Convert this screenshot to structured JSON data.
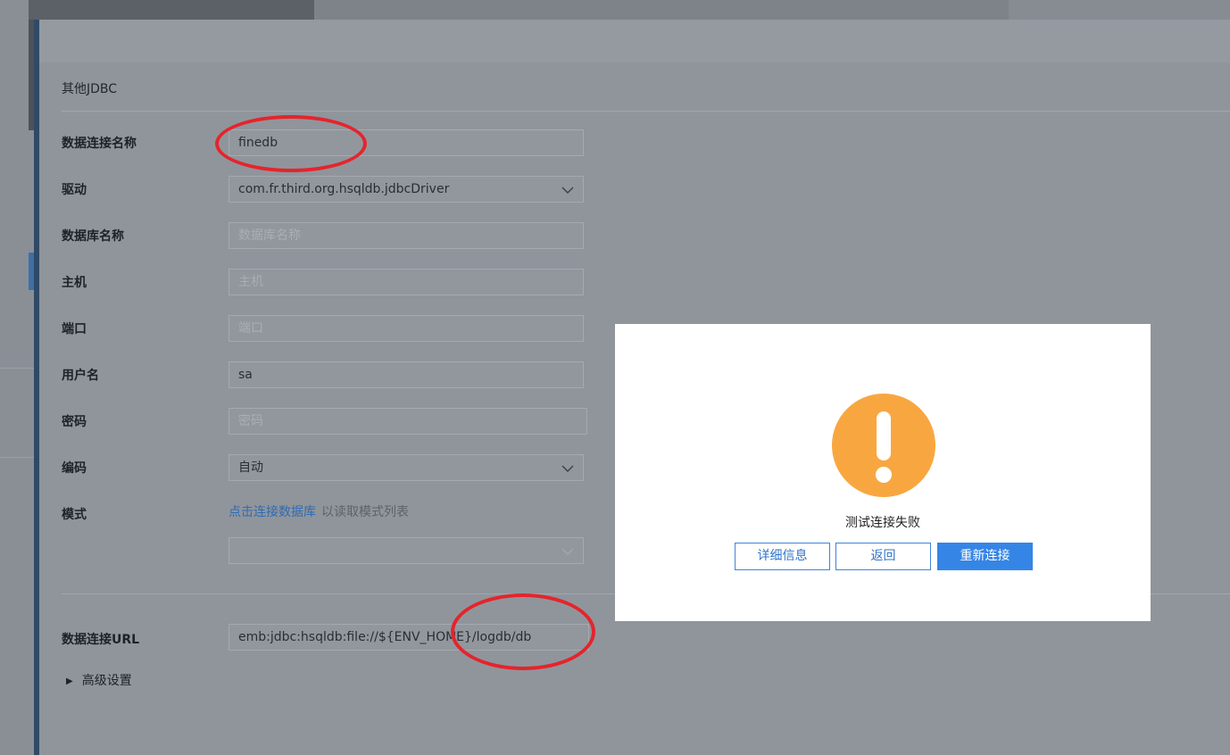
{
  "section": {
    "title": "其他JDBC"
  },
  "form": {
    "connection_name": {
      "label": "数据连接名称",
      "value": "finedb"
    },
    "driver": {
      "label": "驱动",
      "value": "com.fr.third.org.hsqldb.jdbcDriver"
    },
    "database_name": {
      "label": "数据库名称",
      "placeholder": "数据库名称"
    },
    "host": {
      "label": "主机",
      "placeholder": "主机"
    },
    "port": {
      "label": "端口",
      "placeholder": "端口"
    },
    "username": {
      "label": "用户名",
      "value": "sa"
    },
    "password": {
      "label": "密码",
      "placeholder": "密码"
    },
    "encoding": {
      "label": "编码",
      "value": "自动"
    },
    "schema": {
      "label": "模式",
      "link": "点击连接数据库",
      "hint": "以读取模式列表",
      "value": ""
    },
    "url": {
      "label": "数据连接URL",
      "value": "emb:jdbc:hsqldb:file://${ENV_HOME}/logdb/db"
    },
    "advanced": {
      "label": "高级设置"
    }
  },
  "dialog": {
    "icon": "warning-icon",
    "message": "测试连接失败",
    "buttons": {
      "details": "详细信息",
      "back": "返回",
      "reconnect": "重新连接"
    }
  },
  "colors": {
    "warning": "#f8a740",
    "primary": "#3585e6",
    "annotation": "#e5242b",
    "link": "#2e6bb3"
  }
}
